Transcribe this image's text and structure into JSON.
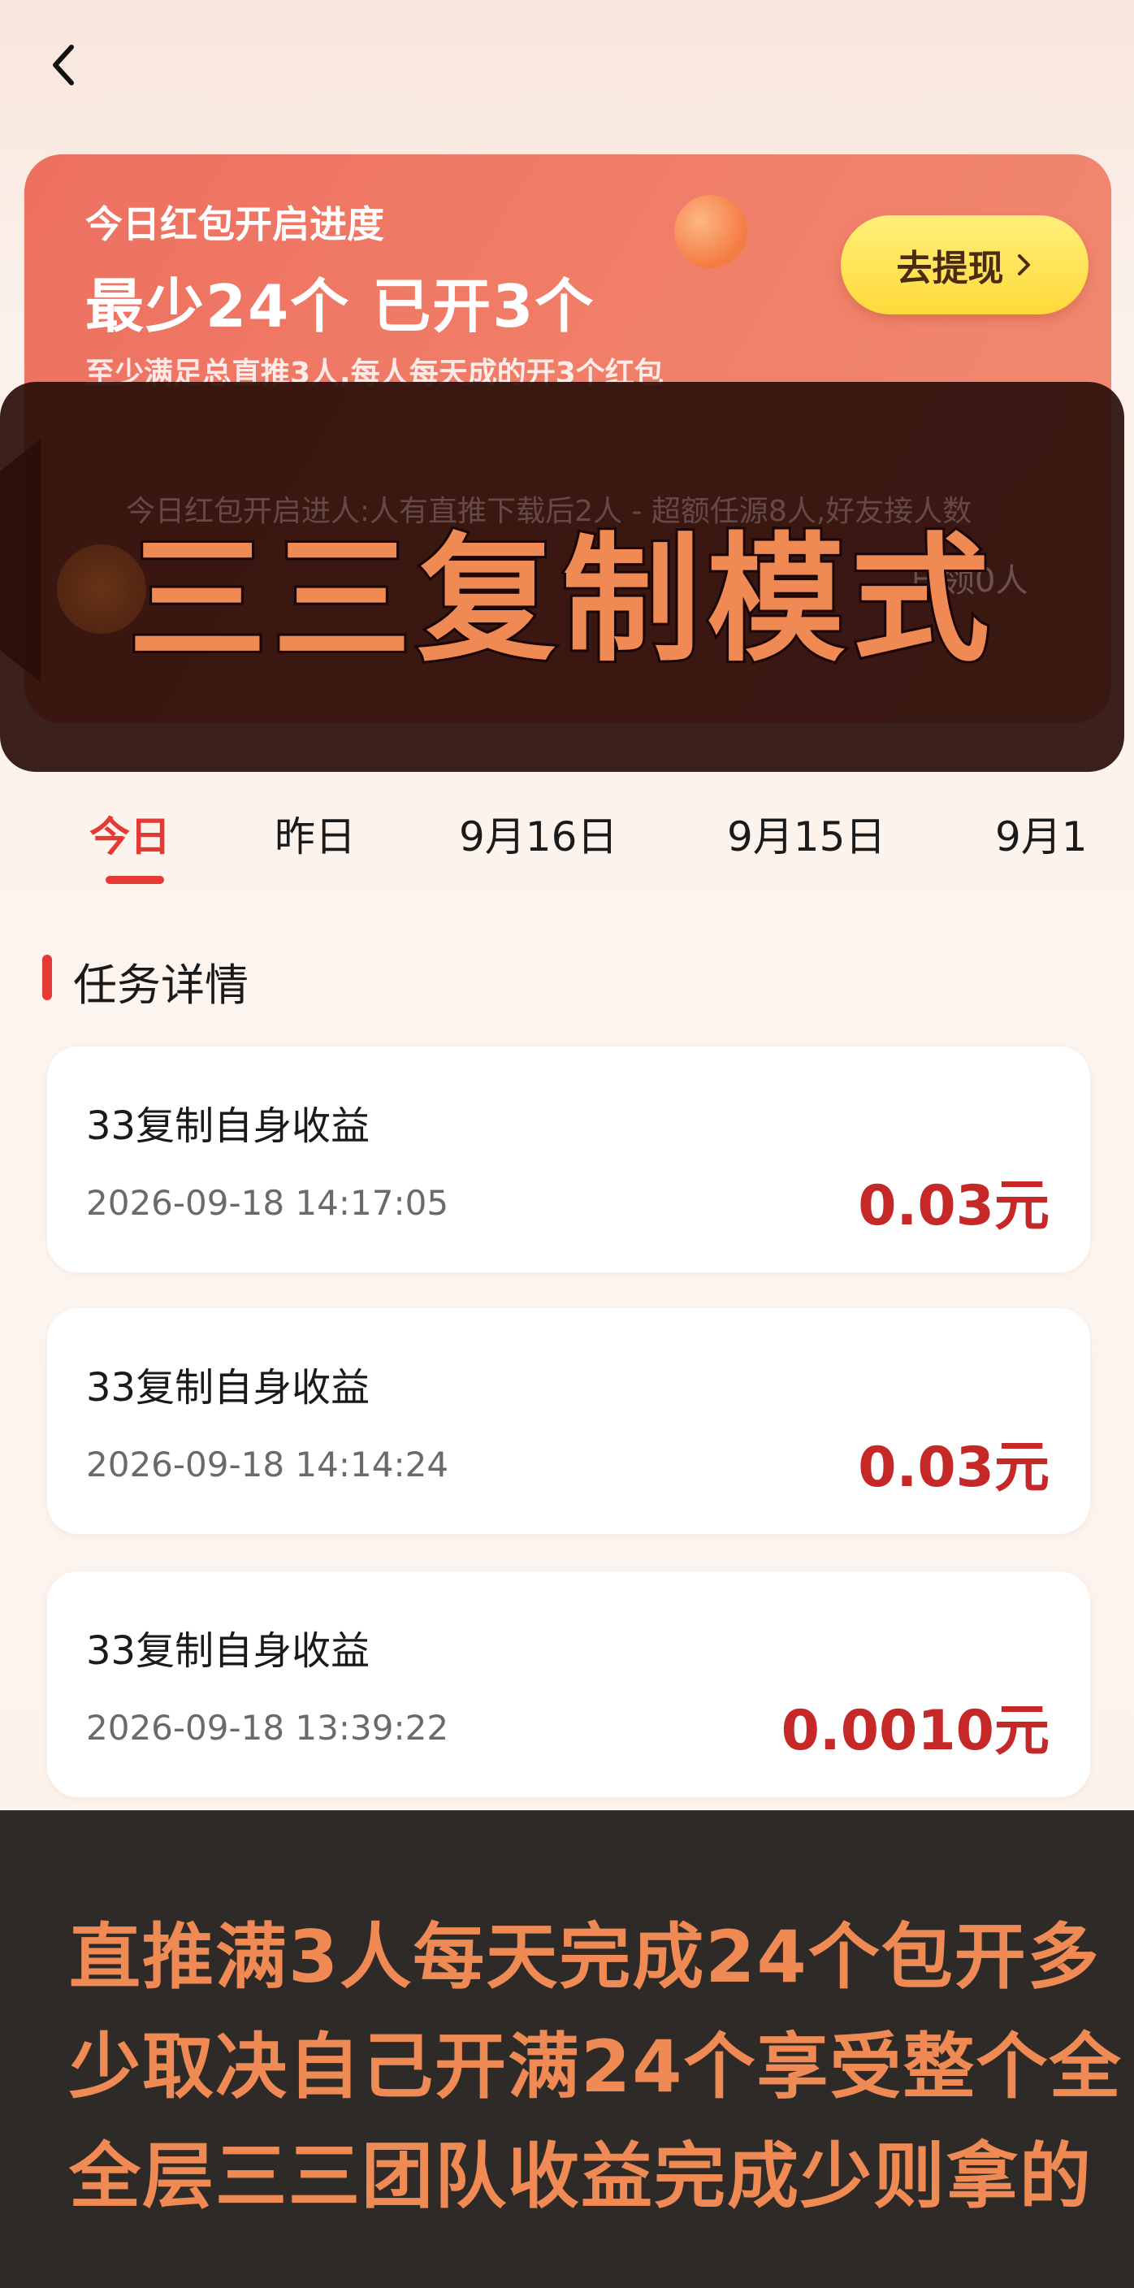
{
  "progress_card": {
    "title": "今日红包开启进度",
    "headline": "最少24个 已开3个",
    "subtitle": "至少满足总直推3人,每人每天成的开3个红包",
    "withdraw_button": "去提现"
  },
  "overlay": {
    "title": "三三复制模式",
    "faint_text_left": "今日红包开启进人:人有直推下载后2人 - 超额任源8人,好友接人数",
    "faint_text_right": "已领0人"
  },
  "date_tabs": [
    "今日",
    "昨日",
    "9月16日",
    "9月15日",
    "9月1"
  ],
  "active_tab_index": 0,
  "section": {
    "title": "任务详情"
  },
  "tasks": [
    {
      "title": "33复制自身收益",
      "time": "2026-09-18 14:17:05",
      "amount": "0.03元"
    },
    {
      "title": "33复制自身收益",
      "time": "2026-09-18 14:14:24",
      "amount": "0.03元"
    },
    {
      "title": "33复制自身收益",
      "time": "2026-09-18 13:39:22",
      "amount": "0.0010元"
    }
  ],
  "caption": {
    "lines": [
      "直推满3人每天完成24个包开多",
      "少取决自己开满24个享受整个全",
      "全层三三团队收益完成少则拿的"
    ]
  },
  "icons": {
    "back": "chevron-left-icon",
    "withdraw_arrow": "chevron-right-icon"
  },
  "colors": {
    "accent": "#e53935",
    "amount": "#c62828",
    "caption_text": "#f08a55",
    "card": "#ef7a66",
    "button": "#ffe14d"
  }
}
